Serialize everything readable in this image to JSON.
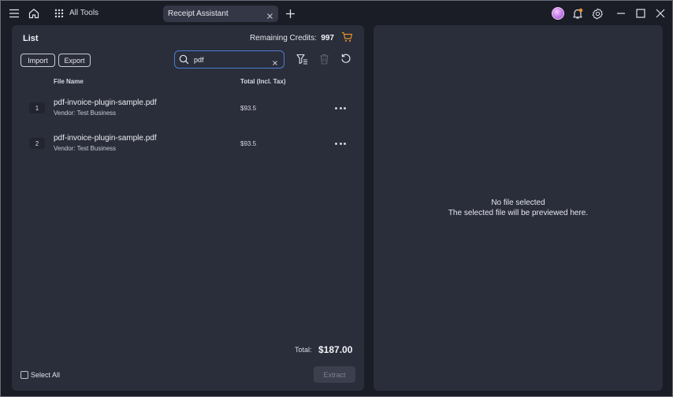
{
  "titlebar": {
    "all_tools_label": "All Tools",
    "tab_label": "Receipt Assistant"
  },
  "list": {
    "title": "List",
    "credits_label": "Remaining Credits:",
    "credits_value": "997",
    "import_label": "Import",
    "export_label": "Export",
    "search_value": "pdf",
    "columns": {
      "file_name": "File Name",
      "total": "Total (Incl. Tax)"
    },
    "rows": [
      {
        "index": "1",
        "file_name": "pdf-invoice-plugin-sample.pdf",
        "vendor": "Vendor: Test Business",
        "total": "$93.5"
      },
      {
        "index": "2",
        "file_name": "pdf-invoice-plugin-sample.pdf",
        "vendor": "Vendor: Test Business",
        "total": "$93.5"
      }
    ],
    "total_label": "Total:",
    "total_value": "$187.00",
    "select_all_label": "Select All",
    "extract_label": "Extract"
  },
  "preview": {
    "empty_title": "No file selected",
    "empty_subtitle": "The selected file will be previewed here."
  },
  "colors": {
    "accent": "#4f7dd6",
    "cart": "#e8912d",
    "notification": "#e8912d",
    "avatar": "#c27ae8"
  }
}
